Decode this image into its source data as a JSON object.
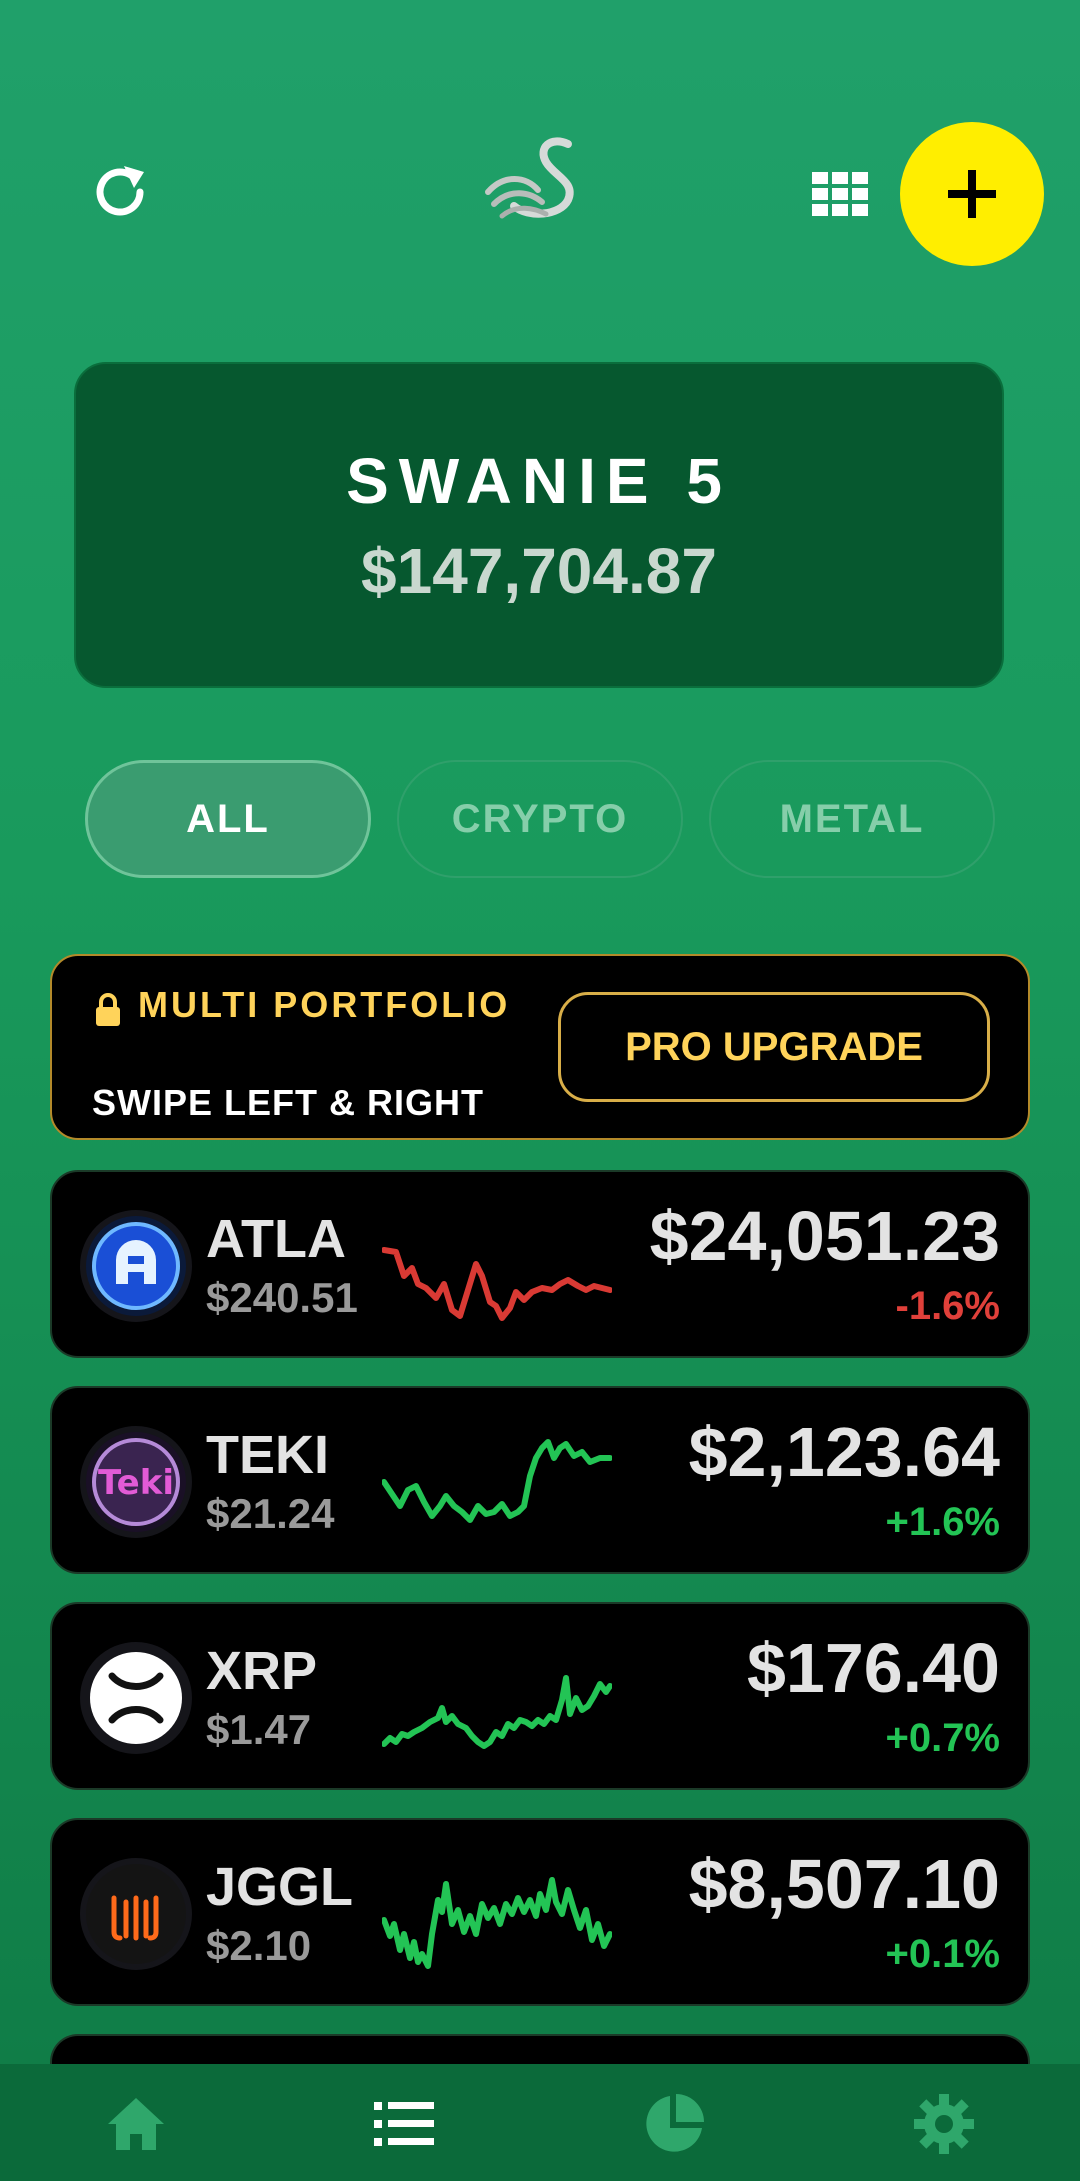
{
  "header": {
    "refresh_icon": "refresh-icon",
    "logo": "swan-logo",
    "grid_icon": "grid-icon",
    "add_icon": "plus-icon",
    "add_button_color": "#ffee00"
  },
  "portfolio": {
    "name": "SWANIE 5",
    "total": "$147,704.87"
  },
  "filters": {
    "tabs": [
      {
        "label": "ALL",
        "active": true
      },
      {
        "label": "CRYPTO",
        "active": false
      },
      {
        "label": "METAL",
        "active": false
      }
    ]
  },
  "promo": {
    "lock_icon": "lock-icon",
    "title": "MULTI PORTFOLIO",
    "subtitle": "SWIPE LEFT & RIGHT",
    "button_label": "PRO UPGRADE"
  },
  "assets": [
    {
      "symbol": "ATLA",
      "price": "$240.51",
      "value": "$24,051.23",
      "change": "-1.6%",
      "trend": "down",
      "color": "#e0403a",
      "icon": "atla-coin-icon"
    },
    {
      "symbol": "TEKI",
      "price": "$21.24",
      "value": "$2,123.64",
      "change": "+1.6%",
      "trend": "up",
      "color": "#23c455",
      "icon": "teki-coin-icon"
    },
    {
      "symbol": "XRP",
      "price": "$1.47",
      "value": "$176.40",
      "change": "+0.7%",
      "trend": "up",
      "color": "#23c455",
      "icon": "xrp-coin-icon"
    },
    {
      "symbol": "JGGL",
      "price": "$2.10",
      "value": "$8,507.10",
      "change": "+0.1%",
      "trend": "up",
      "color": "#23c455",
      "icon": "jggl-coin-icon"
    }
  ],
  "nav": {
    "items": [
      {
        "name": "home",
        "icon": "home-icon"
      },
      {
        "name": "list",
        "icon": "list-icon"
      },
      {
        "name": "allocation",
        "icon": "pie-chart-icon"
      },
      {
        "name": "settings",
        "icon": "gear-icon"
      }
    ]
  }
}
